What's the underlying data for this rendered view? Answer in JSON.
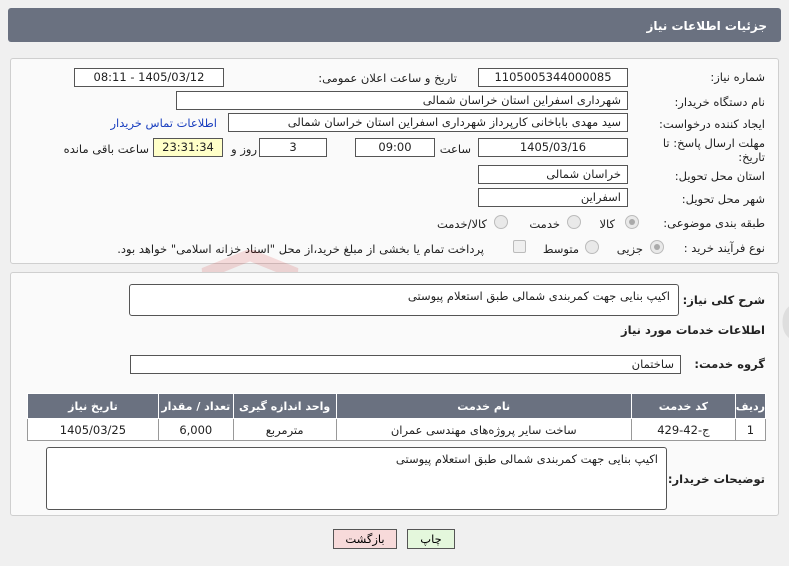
{
  "header": {
    "title": "جزئیات اطلاعات نیاز"
  },
  "details": {
    "need_number_label": "شماره نیاز:",
    "need_number": "1105005344000085",
    "announce_label": "تاریخ و ساعت اعلان عمومی:",
    "announce_value": "1405/03/12 - 08:11",
    "buyer_org_label": "نام دستگاه خریدار:",
    "buyer_org": "شهرداری اسفراین استان خراسان شمالی",
    "creator_label": "ایجاد کننده درخواست:",
    "creator": "سید مهدی  باباخانی کارپرداز   شهرداری اسفراین استان خراسان شمالی",
    "contact_link": "اطلاعات تماس خریدار",
    "deadline_label_1": "مهلت ارسال پاسخ: تا",
    "deadline_label_2": "تاریخ:",
    "deadline_date": "1405/03/16",
    "time_label": "ساعت",
    "deadline_time": "09:00",
    "days_value": "3",
    "days_label": "روز و",
    "remaining_value": "23:31:34",
    "remaining_label": "ساعت باقی مانده",
    "province_label": "استان محل تحویل:",
    "province": "خراسان شمالی",
    "city_label": "شهر محل تحویل:",
    "city": "اسفراین",
    "category_label": "طبقه بندی موضوعی:",
    "category_options": [
      "کالا",
      "خدمت",
      "کالا/خدمت"
    ],
    "category_selected": "کالا",
    "process_label": "نوع فرآیند خرید :",
    "process_options": [
      "جزیی",
      "متوسط"
    ],
    "process_selected": "جزیی",
    "payment_note": "پرداخت تمام یا بخشی از مبلغ خرید،از محل \"اسناد خزانه اسلامی\" خواهد بود."
  },
  "summary": {
    "general_desc_label": "شرح کلی نیاز:",
    "general_desc": "اکیپ بنایی جهت کمربندی شمالی طبق استعلام پیوستی",
    "services_title": "اطلاعات خدمات مورد نیاز",
    "service_group_label": "گروه خدمت:",
    "service_group": "ساختمان",
    "table": {
      "headers": [
        "ردیف",
        "کد خدمت",
        "نام خدمت",
        "واحد اندازه گیری",
        "تعداد / مقدار",
        "تاریخ نیاز"
      ],
      "rows": [
        [
          "1",
          "ج-42-429",
          "ساخت سایر پروژه‌های مهندسی عمران",
          "مترمربع",
          "6,000",
          "1405/03/25"
        ]
      ]
    },
    "buyer_notes_label": "توضیحات خریدار:",
    "buyer_notes": "اکیپ بنایی جهت کمربندی شمالی طبق استعلام پیوستی"
  },
  "buttons": {
    "print": "چاپ",
    "back": "بازگشت"
  },
  "watermark": {
    "text": "AriaTender.net"
  },
  "colors": {
    "header": "#6a7180",
    "link": "#1a3fbf",
    "back_button": "#f7dada",
    "print_button": "#e4f7dc"
  }
}
